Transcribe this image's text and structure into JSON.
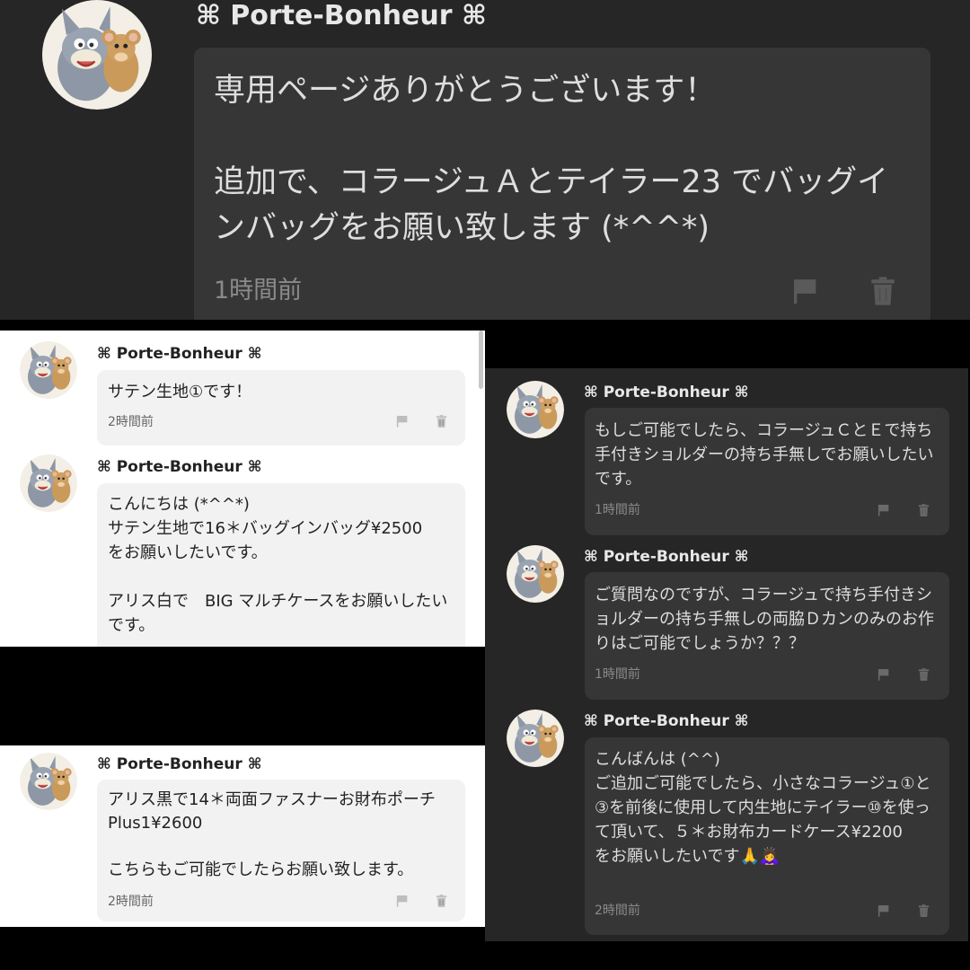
{
  "top": {
    "user": "⌘ Porte-Bonheur ⌘",
    "message": "専用ページありがとうございます！\n\n追加で、コラージュＡとテイラー23 でバッグインバッグをお願い致します (*^^*)",
    "time": "1時間前",
    "avatar_icon": "tom-and-jerry-avatar-icon",
    "flag_icon": "flag-icon",
    "trash_icon": "trash-icon"
  },
  "left_top": {
    "messages": [
      {
        "user": "⌘ Porte-Bonheur ⌘",
        "text": "サテン生地①です！",
        "time": "2時間前"
      },
      {
        "user": "⌘ Porte-Bonheur ⌘",
        "text": "こんにちは (*^^*)\nサテン生地で16＊バッグインバッグ¥2500\nをお願いしたいです。\n\nアリス白で　BIG マルチケースをお願いしたいです。"
      }
    ]
  },
  "left_bottom": {
    "messages": [
      {
        "user": "⌘ Porte-Bonheur ⌘",
        "text": "アリス黒で14＊両面ファスナーお財布ポーチ Plus1¥2600\n\nこちらもご可能でしたらお願い致します。",
        "time": "2時間前"
      }
    ]
  },
  "right": {
    "messages": [
      {
        "user": "⌘ Porte-Bonheur ⌘",
        "text": "もしご可能でしたら、コラージュＣとＥで持ち手付きショルダーの持ち手無しでお願いしたいです。",
        "time": "1時間前"
      },
      {
        "user": "⌘ Porte-Bonheur ⌘",
        "text": "ご質問なのですが、コラージュで持ち手付きショルダーの持ち手無しの両脇Ｄカンのみのお作りはご可能でしょうか？？？",
        "time": "1時間前"
      },
      {
        "user": "⌘ Porte-Bonheur ⌘",
        "text": "こんばんは (^^)\nご追加ご可能でしたら、小さなコラージュ①と③を前後に使用して内生地にテイラー⑩を使って頂いて、５＊お財布カードケース¥2200\nをお願いしたいです🙏🙇‍♀️",
        "time": "2時間前"
      }
    ]
  },
  "colors": {
    "dark_bg": "#262626",
    "dark_bubble": "#363636",
    "light_bg": "#ffffff",
    "light_bubble": "#f2f2f2"
  }
}
